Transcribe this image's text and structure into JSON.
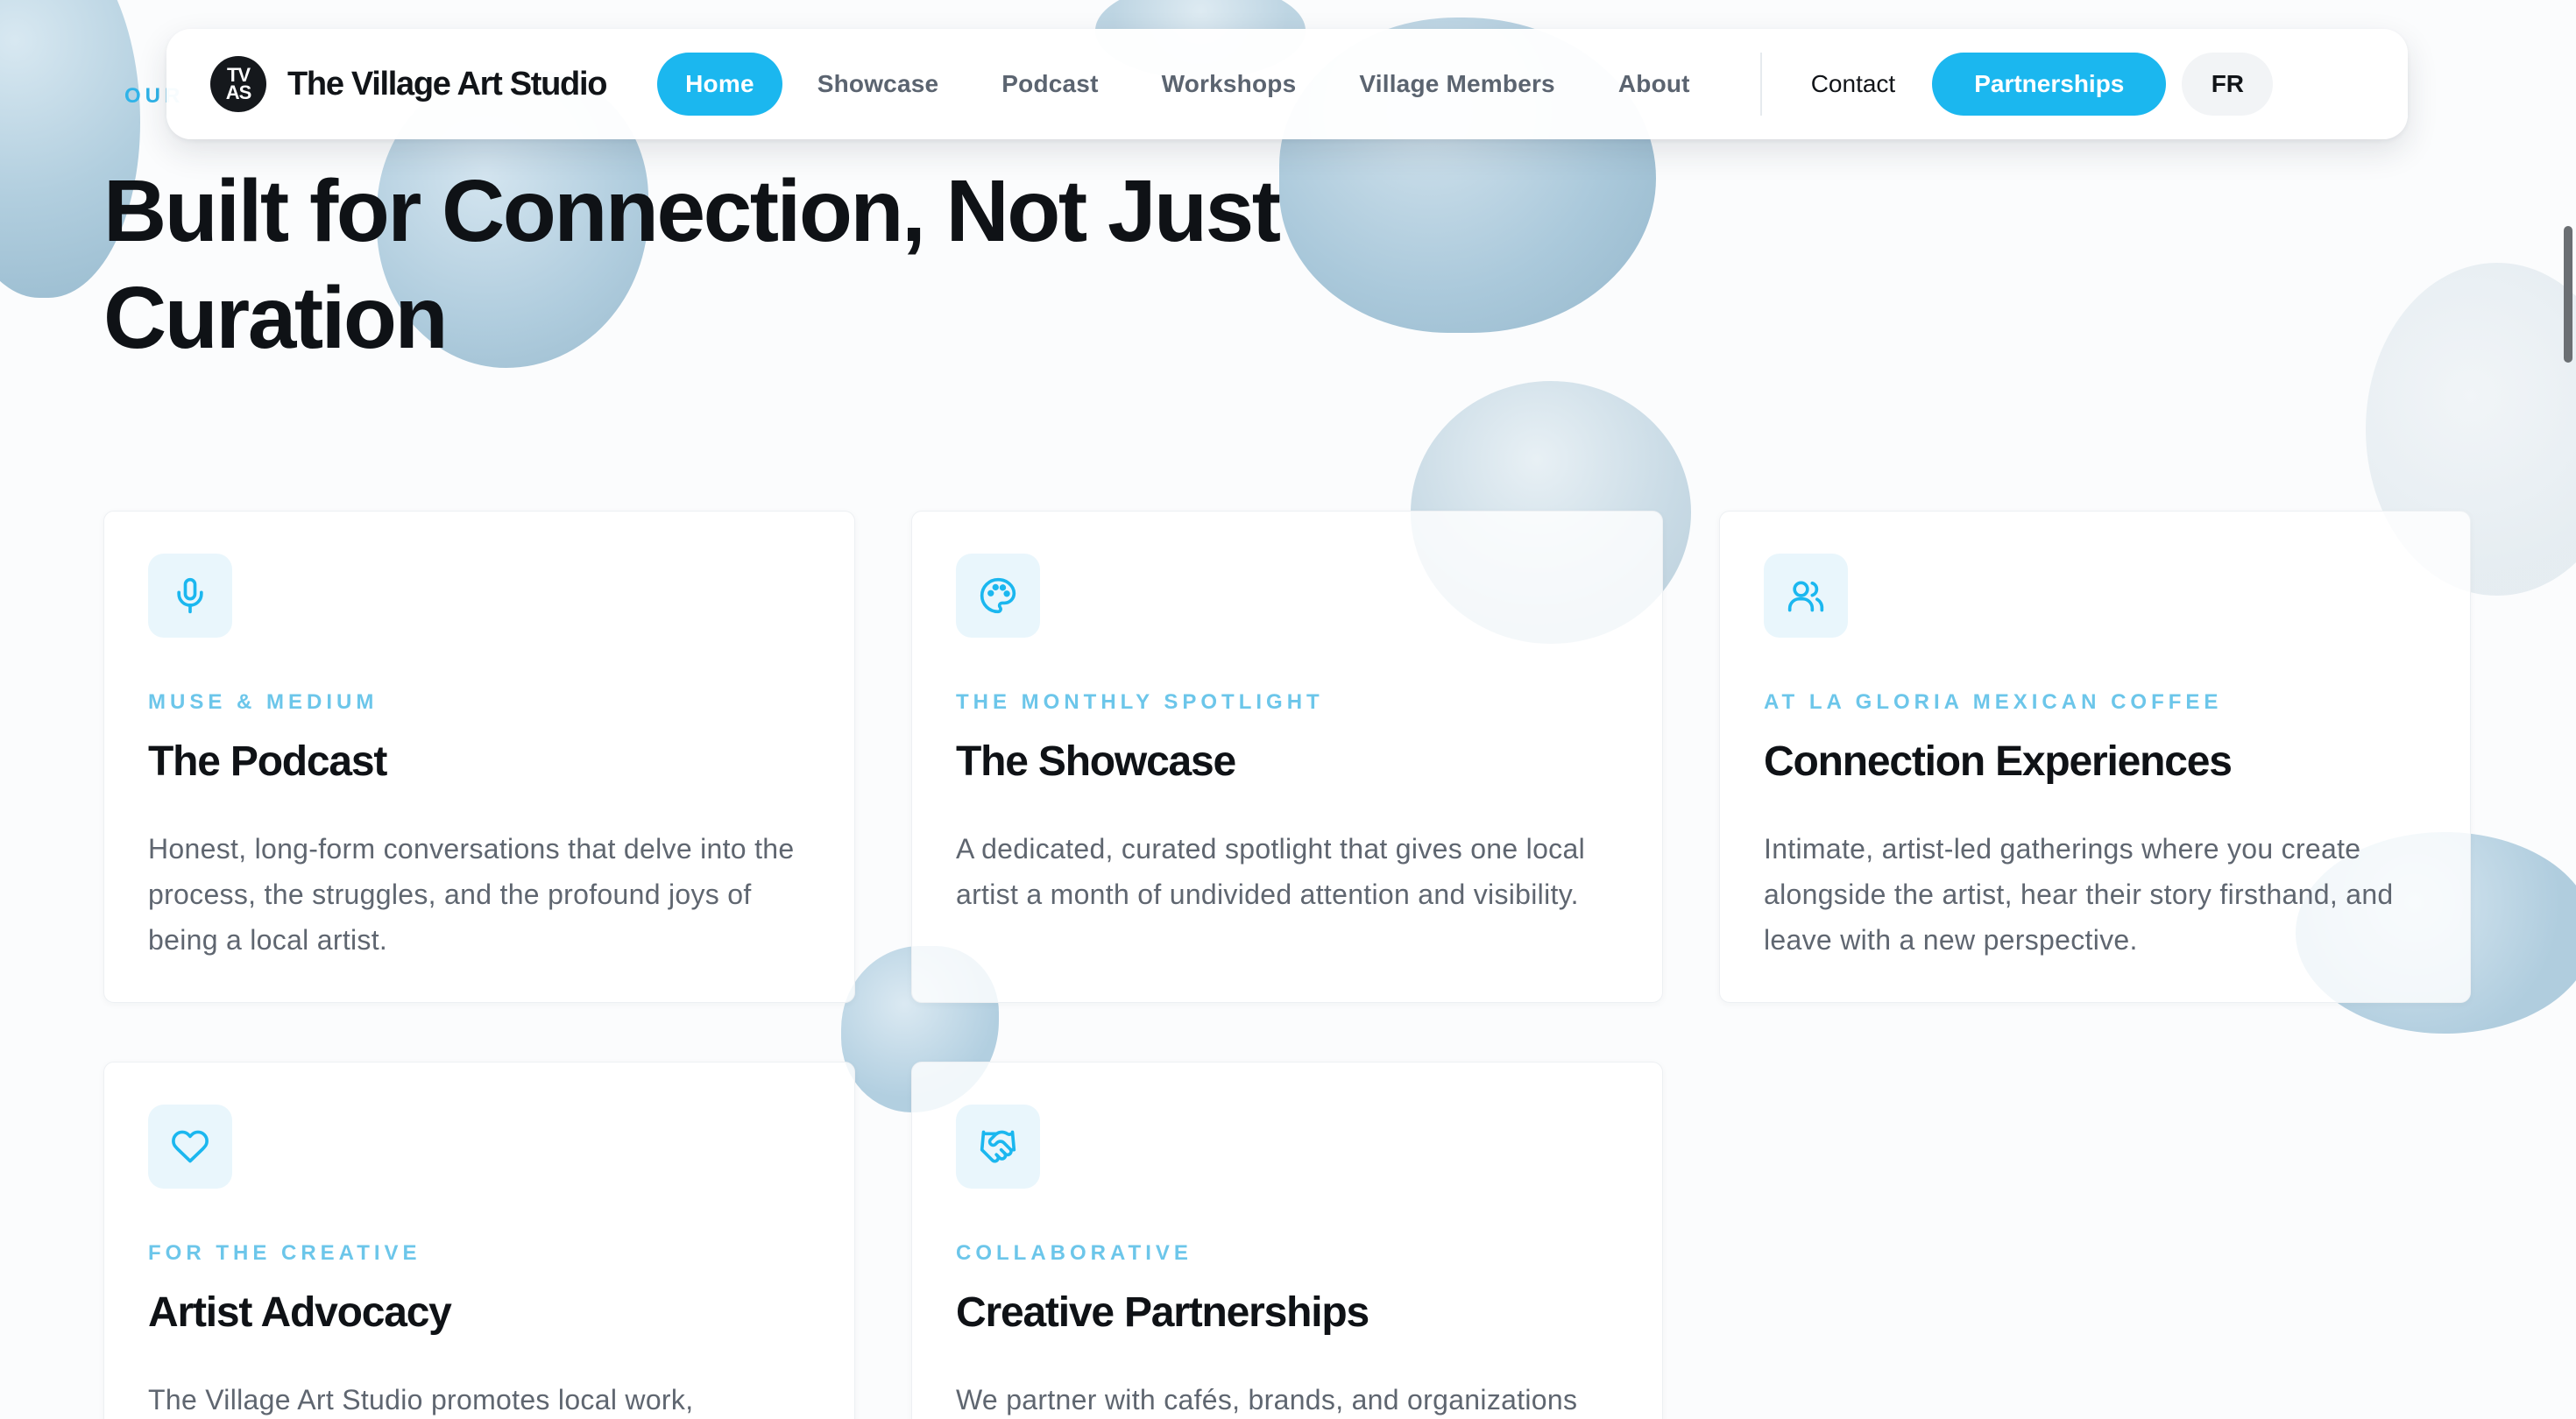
{
  "brand": {
    "logo_top": "TV",
    "logo_bottom": "AS",
    "name": "The Village Art Studio"
  },
  "nav": {
    "links": [
      {
        "label": "Home",
        "active": true
      },
      {
        "label": "Showcase"
      },
      {
        "label": "Podcast"
      },
      {
        "label": "Workshops"
      },
      {
        "label": "Village Members"
      },
      {
        "label": "About"
      }
    ],
    "contact": "Contact",
    "partnerships": "Partnerships",
    "language": "FR"
  },
  "section": {
    "eyebrow": "OUR",
    "title": "Built for Connection, Not Just Curation"
  },
  "cards": [
    {
      "icon": "microphone-icon",
      "kicker": "MUSE & MEDIUM",
      "title": "The Podcast",
      "text": "Honest, long-form conversations that delve into the process, the struggles, and the profound joys of being a local artist."
    },
    {
      "icon": "palette-icon",
      "kicker": "THE MONTHLY SPOTLIGHT",
      "title": "The Showcase",
      "text": "A dedicated, curated spotlight that gives one local artist a month of undivided attention and visibility."
    },
    {
      "icon": "users-icon",
      "kicker": "AT LA GLORIA MEXICAN COFFEE",
      "title": "Connection Experiences",
      "text": "Intimate, artist-led gatherings where you create alongside the artist, hear their story firsthand, and leave with a new perspective."
    },
    {
      "icon": "heart-icon",
      "kicker": "FOR THE CREATIVE",
      "title": "Artist Advocacy",
      "text": "The Village Art Studio promotes local work,"
    },
    {
      "icon": "handshake-icon",
      "kicker": "COLLABORATIVE",
      "title": "Creative Partnerships",
      "text": "We partner with cafés, brands, and organizations"
    }
  ],
  "colors": {
    "accent": "#1bb7ef",
    "kicker": "#6cc6ea",
    "heading": "#0f1216",
    "body": "#5f6670"
  }
}
